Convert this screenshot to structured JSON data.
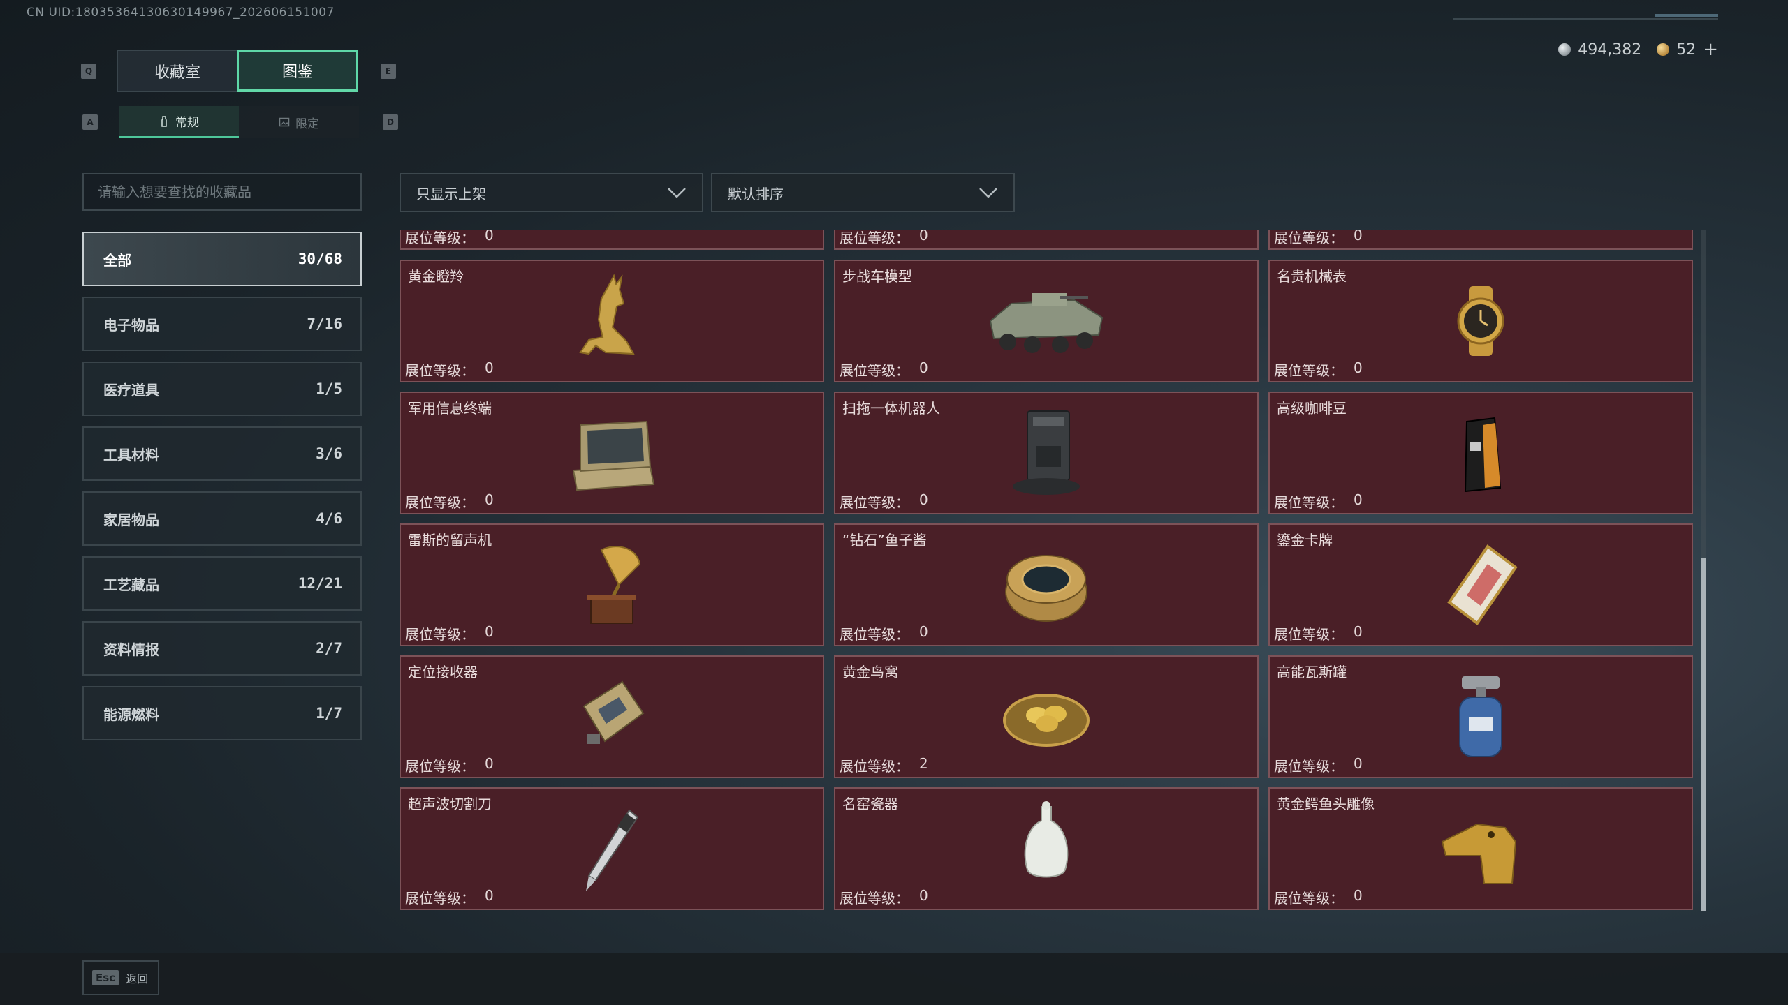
{
  "uid": "CN UID:18035364130630149967_202606151007",
  "currency": {
    "silver": "494,382",
    "gold": "52",
    "add": "+"
  },
  "keys": {
    "q": "Q",
    "e": "E",
    "a": "A",
    "d": "D"
  },
  "tabs": [
    "收藏室",
    "图鉴"
  ],
  "subtabs": [
    "常规",
    "限定"
  ],
  "search": {
    "placeholder": "请输入想要查找的收藏品"
  },
  "categories": [
    {
      "label": "全部",
      "count": "30/68"
    },
    {
      "label": "电子物品",
      "count": "7/16"
    },
    {
      "label": "医疗道具",
      "count": "1/5"
    },
    {
      "label": "工具材料",
      "count": "3/6"
    },
    {
      "label": "家居物品",
      "count": "4/6"
    },
    {
      "label": "工艺藏品",
      "count": "12/21"
    },
    {
      "label": "资料情报",
      "count": "2/7"
    },
    {
      "label": "能源燃料",
      "count": "1/7"
    }
  ],
  "filter": {
    "show": "只显示上架",
    "sort": "默认排序"
  },
  "level_label": "展位等级：",
  "top_partial": [
    "0",
    "0",
    "0"
  ],
  "items": [
    {
      "name": "黄金瞪羚",
      "level": "0",
      "icon": "gazelle-icon"
    },
    {
      "name": "步战车模型",
      "level": "0",
      "icon": "ifv-model-icon"
    },
    {
      "name": "名贵机械表",
      "level": "0",
      "icon": "watch-icon"
    },
    {
      "name": "军用信息终端",
      "level": "0",
      "icon": "terminal-icon"
    },
    {
      "name": "扫拖一体机器人",
      "level": "0",
      "icon": "robot-vacuum-icon"
    },
    {
      "name": "高级咖啡豆",
      "level": "0",
      "icon": "coffee-bag-icon"
    },
    {
      "name": "雷斯的留声机",
      "level": "0",
      "icon": "gramophone-icon"
    },
    {
      "name": "“钻石”鱼子酱",
      "level": "0",
      "icon": "caviar-tin-icon"
    },
    {
      "name": "鎏金卡牌",
      "level": "0",
      "icon": "gold-card-icon"
    },
    {
      "name": "定位接收器",
      "level": "0",
      "icon": "receiver-icon"
    },
    {
      "name": "黄金鸟窝",
      "level": "2",
      "icon": "golden-nest-icon"
    },
    {
      "name": "高能瓦斯罐",
      "level": "0",
      "icon": "gas-canister-icon"
    },
    {
      "name": "超声波切割刀",
      "level": "0",
      "icon": "ultrasonic-cutter-icon"
    },
    {
      "name": "名窑瓷器",
      "level": "0",
      "icon": "porcelain-vase-icon"
    },
    {
      "name": "黄金鳄鱼头雕像",
      "level": "0",
      "icon": "crocodile-statue-icon"
    }
  ],
  "footer": {
    "esc": "Esc",
    "back": "返回"
  }
}
